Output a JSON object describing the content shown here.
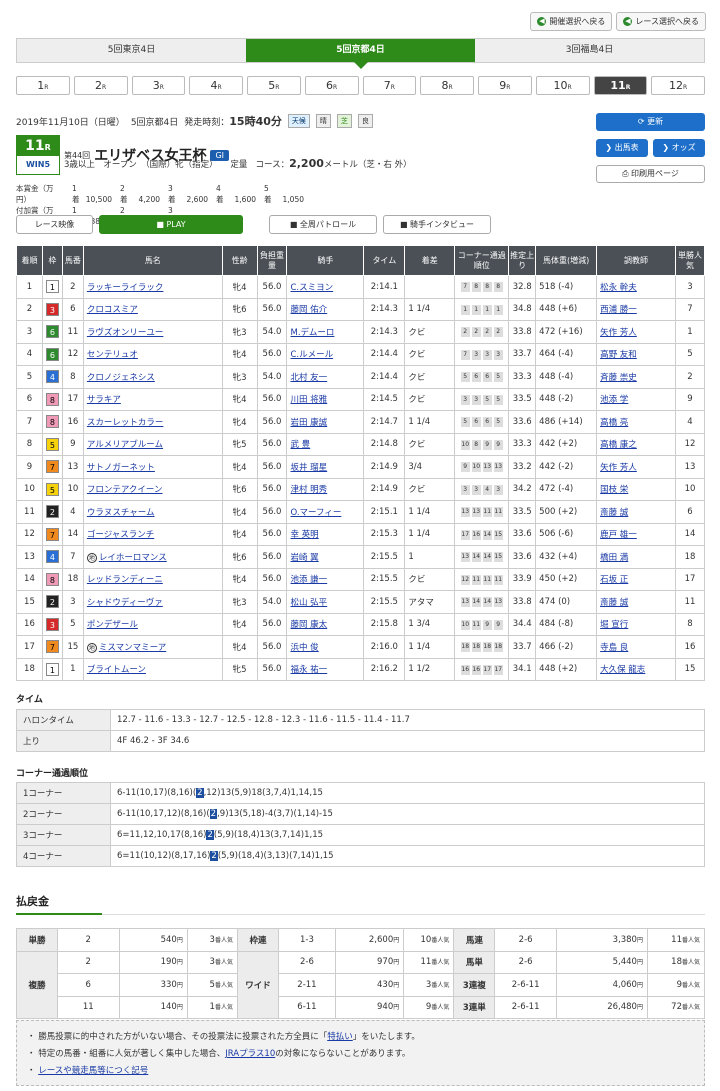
{
  "top_buttons": [
    "開催選択へ戻る",
    "レース選択へ戻る"
  ],
  "venues": [
    "5回東京4日",
    "5回京都4日",
    "3回福島4日"
  ],
  "venue_selected": 1,
  "races": [
    "1",
    "2",
    "3",
    "4",
    "5",
    "6",
    "7",
    "8",
    "9",
    "10",
    "11",
    "12"
  ],
  "race_suffix": "R",
  "race_selected": 10,
  "race_info": {
    "date": "2019年11月10日（日曜）",
    "meeting": "5回京都4日",
    "post_label": "発走時刻：",
    "post_time": "15時40分",
    "weather_label": "天候",
    "weather": "晴",
    "track_label": "芝",
    "track_cond": "良",
    "race_no": "11",
    "race_no_suffix": "R",
    "win5": "WIN5",
    "edition": "第44回",
    "name": "エリザベス女王杯",
    "grade": "GⅠ",
    "conditions": "3歳以上　オープン　（国際）牝（指定）　　定量",
    "course_label": "コース：",
    "distance": "2,200",
    "distance_unit": "メートル（芝・右 外）"
  },
  "prize": {
    "row1_label": "本賞金（万円）",
    "row1": [
      "1着",
      "10,500",
      "2着",
      "4,200",
      "3着",
      "2,600",
      "4着",
      "1,600",
      "5着",
      "1,050"
    ],
    "row2_label": "付加賞（万円）",
    "row2": [
      "1着",
      "382.2",
      "2着",
      "109.2",
      "3着",
      "54.6"
    ]
  },
  "right_buttons": {
    "refresh": "更新",
    "entries": "出馬表",
    "odds": "オッズ",
    "print": "印刷用ページ"
  },
  "media": {
    "video_label": "レース映像",
    "play": "PLAY",
    "patrol": "全周パトロール",
    "interview": "騎手インタビュー"
  },
  "table_headers": [
    "着順",
    "枠",
    "馬番",
    "馬名",
    "性齢",
    "負担重量",
    "騎手",
    "タイム",
    "着差",
    "コーナー通過順位",
    "推定上り",
    "馬体重(増減)",
    "調教師",
    "単勝人気"
  ],
  "results": [
    {
      "pos": "1",
      "waku": "1",
      "num": "2",
      "horse": "ラッキーライラック",
      "sa": "牝4",
      "wt": "56.0",
      "jockey": "C.スミヨン",
      "time": "2:14.1",
      "margin": "",
      "corners": [
        "7",
        "8",
        "8",
        "8"
      ],
      "last": "32.8",
      "bw": "518 (-4)",
      "trainer": "松永 幹夫",
      "pop": "3",
      "wc": "#ffffff",
      "tc": "#000"
    },
    {
      "pos": "2",
      "waku": "3",
      "num": "6",
      "horse": "クロコスミア",
      "sa": "牝6",
      "wt": "56.0",
      "jockey": "藤岡 佑介",
      "time": "2:14.3",
      "margin": "1 1/4",
      "corners": [
        "1",
        "1",
        "1",
        "1"
      ],
      "last": "34.8",
      "bw": "448 (+6)",
      "trainer": "西浦 勝一",
      "pop": "7",
      "wc": "#d62a2a",
      "tc": "#fff"
    },
    {
      "pos": "3",
      "waku": "6",
      "num": "11",
      "horse": "ラヴズオンリーユー",
      "sa": "牝3",
      "wt": "54.0",
      "jockey": "M.デムーロ",
      "time": "2:14.3",
      "margin": "クビ",
      "corners": [
        "2",
        "2",
        "2",
        "2"
      ],
      "last": "33.8",
      "bw": "472 (+16)",
      "trainer": "矢作 芳人",
      "pop": "1",
      "wc": "#2e8a2e",
      "tc": "#fff"
    },
    {
      "pos": "4",
      "waku": "6",
      "num": "12",
      "horse": "センテリュオ",
      "sa": "牝4",
      "wt": "56.0",
      "jockey": "C.ルメール",
      "time": "2:14.4",
      "margin": "クビ",
      "corners": [
        "7",
        "3",
        "3",
        "3"
      ],
      "last": "33.7",
      "bw": "464 (-4)",
      "trainer": "高野 友和",
      "pop": "5",
      "wc": "#2e8a2e",
      "tc": "#fff"
    },
    {
      "pos": "5",
      "waku": "4",
      "num": "8",
      "horse": "クロノジェネシス",
      "sa": "牝3",
      "wt": "54.0",
      "jockey": "北村 友一",
      "time": "2:14.4",
      "margin": "クビ",
      "corners": [
        "5",
        "6",
        "6",
        "5"
      ],
      "last": "33.3",
      "bw": "448 (-4)",
      "trainer": "斉藤 崇史",
      "pop": "2",
      "wc": "#2a6fd6",
      "tc": "#fff"
    },
    {
      "pos": "6",
      "waku": "8",
      "num": "17",
      "horse": "サラキア",
      "sa": "牝4",
      "wt": "56.0",
      "jockey": "川田 将雅",
      "time": "2:14.5",
      "margin": "クビ",
      "corners": [
        "3",
        "3",
        "5",
        "5"
      ],
      "last": "33.5",
      "bw": "448 (-2)",
      "trainer": "池添 学",
      "pop": "9",
      "wc": "#f19ab8",
      "tc": "#000"
    },
    {
      "pos": "7",
      "waku": "8",
      "num": "16",
      "horse": "スカーレットカラー",
      "sa": "牝4",
      "wt": "56.0",
      "jockey": "岩田 康誠",
      "time": "2:14.7",
      "margin": "1 1/4",
      "corners": [
        "5",
        "6",
        "6",
        "5"
      ],
      "last": "33.6",
      "bw": "486 (+14)",
      "trainer": "高橋 亮",
      "pop": "4",
      "wc": "#f19ab8",
      "tc": "#000"
    },
    {
      "pos": "8",
      "waku": "5",
      "num": "9",
      "horse": "アルメリアブルーム",
      "sa": "牝5",
      "wt": "56.0",
      "jockey": "武 豊",
      "time": "2:14.8",
      "margin": "クビ",
      "corners": [
        "10",
        "8",
        "9",
        "9"
      ],
      "last": "33.3",
      "bw": "442 (+2)",
      "trainer": "高橋 康之",
      "pop": "12",
      "wc": "#f5d20c",
      "tc": "#000"
    },
    {
      "pos": "9",
      "waku": "7",
      "num": "13",
      "horse": "サトノガーネット",
      "sa": "牝4",
      "wt": "56.0",
      "jockey": "坂井 瑠星",
      "time": "2:14.9",
      "margin": "3/4",
      "corners": [
        "9",
        "10",
        "13",
        "13"
      ],
      "last": "33.2",
      "bw": "442 (-2)",
      "trainer": "矢作 芳人",
      "pop": "13",
      "wc": "#f08a1e",
      "tc": "#000"
    },
    {
      "pos": "10",
      "waku": "5",
      "num": "10",
      "horse": "フロンテアクイーン",
      "sa": "牝6",
      "wt": "56.0",
      "jockey": "津村 明秀",
      "time": "2:14.9",
      "margin": "クビ",
      "corners": [
        "3",
        "3",
        "4",
        "3"
      ],
      "last": "34.2",
      "bw": "472 (-4)",
      "trainer": "国枝 栄",
      "pop": "10",
      "wc": "#f5d20c",
      "tc": "#000"
    },
    {
      "pos": "11",
      "waku": "2",
      "num": "4",
      "horse": "ウラヌスチャーム",
      "sa": "牝4",
      "wt": "56.0",
      "jockey": "O.マーフィー",
      "time": "2:15.1",
      "margin": "1 1/4",
      "corners": [
        "13",
        "13",
        "11",
        "11"
      ],
      "last": "33.5",
      "bw": "500 (+2)",
      "trainer": "斎藤 誠",
      "pop": "6",
      "wc": "#222222",
      "tc": "#fff"
    },
    {
      "pos": "12",
      "waku": "7",
      "num": "14",
      "horse": "ゴージャスランチ",
      "sa": "牝4",
      "wt": "56.0",
      "jockey": "幸 英明",
      "time": "2:15.3",
      "margin": "1 1/4",
      "corners": [
        "17",
        "16",
        "14",
        "15"
      ],
      "last": "33.6",
      "bw": "506 (-6)",
      "trainer": "鹿戸 雄一",
      "pop": "14",
      "wc": "#f08a1e",
      "tc": "#000"
    },
    {
      "pos": "13",
      "waku": "4",
      "num": "7",
      "horse": "レイホーロマンス",
      "sa": "牝6",
      "wt": "56.0",
      "jockey": "岩崎 翼",
      "time": "2:15.5",
      "margin": "1",
      "corners": [
        "13",
        "14",
        "14",
        "15"
      ],
      "last": "33.6",
      "bw": "432 (+4)",
      "trainer": "橋田 満",
      "pop": "18",
      "wc": "#2a6fd6",
      "tc": "#fff",
      "mark": "地"
    },
    {
      "pos": "14",
      "waku": "8",
      "num": "18",
      "horse": "レッドランディーニ",
      "sa": "牝4",
      "wt": "56.0",
      "jockey": "池添 謙一",
      "time": "2:15.5",
      "margin": "クビ",
      "corners": [
        "12",
        "11",
        "11",
        "11"
      ],
      "last": "33.9",
      "bw": "450 (+2)",
      "trainer": "石坂 正",
      "pop": "17",
      "wc": "#f19ab8",
      "tc": "#000"
    },
    {
      "pos": "15",
      "waku": "2",
      "num": "3",
      "horse": "シャドウディーヴァ",
      "sa": "牝3",
      "wt": "54.0",
      "jockey": "松山 弘平",
      "time": "2:15.5",
      "margin": "アタマ",
      "corners": [
        "13",
        "14",
        "14",
        "13"
      ],
      "last": "33.8",
      "bw": "474 (0)",
      "trainer": "斎藤 誠",
      "pop": "11",
      "wc": "#222222",
      "tc": "#fff"
    },
    {
      "pos": "16",
      "waku": "3",
      "num": "5",
      "horse": "ポンデザール",
      "sa": "牝4",
      "wt": "56.0",
      "jockey": "藤岡 康太",
      "time": "2:15.8",
      "margin": "1 3/4",
      "corners": [
        "10",
        "11",
        "9",
        "9"
      ],
      "last": "34.4",
      "bw": "484 (-8)",
      "trainer": "堀 宣行",
      "pop": "8",
      "wc": "#d62a2a",
      "tc": "#fff"
    },
    {
      "pos": "17",
      "waku": "7",
      "num": "15",
      "horse": "ミスマンマミーア",
      "sa": "牝4",
      "wt": "56.0",
      "jockey": "浜中 俊",
      "time": "2:16.0",
      "margin": "1 1/4",
      "corners": [
        "18",
        "18",
        "18",
        "18"
      ],
      "last": "33.7",
      "bw": "466 (-2)",
      "trainer": "寺島 良",
      "pop": "16",
      "wc": "#f08a1e",
      "tc": "#000",
      "mark": "地"
    },
    {
      "pos": "18",
      "waku": "1",
      "num": "1",
      "horse": "ブライトムーン",
      "sa": "牝5",
      "wt": "56.0",
      "jockey": "福永 祐一",
      "time": "2:16.2",
      "margin": "1 1/2",
      "corners": [
        "16",
        "16",
        "17",
        "17"
      ],
      "last": "34.1",
      "bw": "448 (+2)",
      "trainer": "大久保 龍志",
      "pop": "15",
      "wc": "#ffffff",
      "tc": "#000"
    }
  ],
  "time_section": {
    "title": "タイム",
    "rows": [
      {
        "k": "ハロンタイム",
        "v": "12.7 - 11.6 - 13.3 - 12.7 - 12.5 - 12.8 - 12.3 - 11.6 - 11.5 - 11.4 - 11.7"
      },
      {
        "k": "上り",
        "v": "4F 46.2 - 3F 34.6"
      }
    ]
  },
  "corner_section": {
    "title": "コーナー通過順位",
    "rows": [
      {
        "k": "1コーナー",
        "pre": "6-11(10,17)(8,16)(",
        "hl": "2",
        "post": ",12)13(5,9)18(3,7,4)1,14,15"
      },
      {
        "k": "2コーナー",
        "pre": "6-11(10,17,12)(8,16)(",
        "hl": "2",
        "post": ",9)13(5,18)-4(3,7)(1,14)-15"
      },
      {
        "k": "3コーナー",
        "pre": "6=11,12,10,17(8,16)",
        "hl": "2",
        "post": "(5,9)(18,4)13(3,7,14)1,15"
      },
      {
        "k": "4コーナー",
        "pre": "6=11(10,12)(8,17,16)",
        "hl": "2",
        "post": "(5,9)(18,4)(3,13)(7,14)1,15"
      }
    ]
  },
  "payout": {
    "title": "払戻金",
    "yen": "円",
    "pop_suffix": "番人気",
    "win": {
      "label": "単勝",
      "rows": [
        {
          "c": "2",
          "y": "540",
          "p": "3"
        }
      ]
    },
    "place": {
      "label": "複勝",
      "rows": [
        {
          "c": "2",
          "y": "190",
          "p": "3"
        },
        {
          "c": "6",
          "y": "330",
          "p": "5"
        },
        {
          "c": "11",
          "y": "140",
          "p": "1"
        }
      ]
    },
    "bracket": {
      "label": "枠連",
      "rows": [
        {
          "c": "1-3",
          "y": "2,600",
          "p": "10"
        }
      ]
    },
    "wide": {
      "label": "ワイド",
      "rows": [
        {
          "c": "2-6",
          "y": "970",
          "p": "11"
        },
        {
          "c": "2-11",
          "y": "430",
          "p": "3"
        },
        {
          "c": "6-11",
          "y": "940",
          "p": "9"
        }
      ]
    },
    "quinella": {
      "label": "馬連",
      "rows": [
        {
          "c": "2-6",
          "y": "3,380",
          "p": "11"
        }
      ]
    },
    "exacta": {
      "label": "馬単",
      "rows": [
        {
          "c": "2-6",
          "y": "5,440",
          "p": "18"
        }
      ]
    },
    "trio": {
      "label": "3連複",
      "rows": [
        {
          "c": "2-6-11",
          "y": "4,060",
          "p": "9"
        }
      ]
    },
    "trifecta": {
      "label": "3連単",
      "rows": [
        {
          "c": "2-6-11",
          "y": "26,480",
          "p": "72"
        }
      ]
    }
  },
  "notes": {
    "n1_pre": "勝馬投票に的中された方がいない場合、その投票法に投票された方全員に「",
    "n1_link": "特払い",
    "n1_post": "」をいたします。",
    "n2_pre": "特定の馬番・組番に人気が著しく集中した場合、",
    "n2_link": "JRAプラス10",
    "n2_post": "の対象にならないことがあります。",
    "n3_link": "レースや競走馬等につく記号"
  },
  "colors": {
    "accent_green": "#2e8a19",
    "button_blue": "#1d6fc9",
    "header_gray": "#4a5056"
  }
}
